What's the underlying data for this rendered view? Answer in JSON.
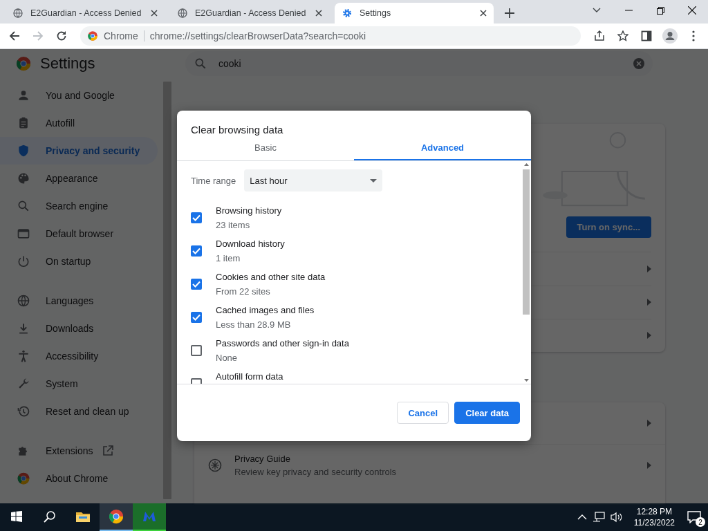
{
  "tabs": [
    {
      "title": "E2Guardian - Access Denied",
      "kind": "web",
      "selected": false
    },
    {
      "title": "E2Guardian - Access Denied",
      "kind": "web",
      "selected": false
    },
    {
      "title": "Settings",
      "kind": "settings",
      "selected": true
    }
  ],
  "toolbar": {
    "chip": "Chrome",
    "url": "chrome://settings/clearBrowserData?search=cooki"
  },
  "settings": {
    "title": "Settings",
    "search": {
      "value": "cooki"
    },
    "sidebar": {
      "groups": [
        [
          {
            "label": "You and Google",
            "selected": false
          },
          {
            "label": "Autofill",
            "selected": false
          },
          {
            "label": "Privacy and security",
            "selected": true
          },
          {
            "label": "Appearance",
            "selected": false
          },
          {
            "label": "Search engine",
            "selected": false
          },
          {
            "label": "Default browser",
            "selected": false
          },
          {
            "label": "On startup",
            "selected": false
          }
        ],
        [
          {
            "label": "Languages",
            "selected": false
          },
          {
            "label": "Downloads",
            "selected": false
          },
          {
            "label": "Accessibility",
            "selected": false
          },
          {
            "label": "System",
            "selected": false
          },
          {
            "label": "Reset and clean up",
            "selected": false
          }
        ],
        [
          {
            "label": "Extensions",
            "selected": false,
            "external": true
          },
          {
            "label": "About Chrome",
            "selected": false
          }
        ]
      ]
    },
    "sync_card": {
      "button": "Turn on sync..."
    },
    "privacy_card": {
      "rows": [
        {
          "title": "Privacy Guide",
          "subtitle": "Review key privacy and security controls"
        }
      ]
    }
  },
  "dialog": {
    "title": "Clear browsing data",
    "tabs": [
      {
        "label": "Basic",
        "selected": false
      },
      {
        "label": "Advanced",
        "selected": true
      }
    ],
    "time_range": {
      "label": "Time range",
      "value": "Last hour"
    },
    "items": [
      {
        "label": "Browsing history",
        "detail": "23 items",
        "checked": true
      },
      {
        "label": "Download history",
        "detail": "1 item",
        "checked": true
      },
      {
        "label": "Cookies and other site data",
        "detail": "From 22 sites",
        "checked": true
      },
      {
        "label": "Cached images and files",
        "detail": "Less than 28.9 MB",
        "checked": true
      },
      {
        "label": "Passwords and other sign-in data",
        "detail": "None",
        "checked": false
      },
      {
        "label": "Autofill form data",
        "checked": false
      }
    ],
    "buttons": [
      {
        "label": "Cancel",
        "kind": "secondary"
      },
      {
        "label": "Clear data",
        "kind": "primary"
      }
    ]
  },
  "taskbar": {
    "apps": [
      {
        "active": false
      },
      {
        "active": true
      },
      {
        "active": true
      }
    ],
    "time": "12:28 PM",
    "date": "11/23/2022",
    "notifications": "2"
  }
}
